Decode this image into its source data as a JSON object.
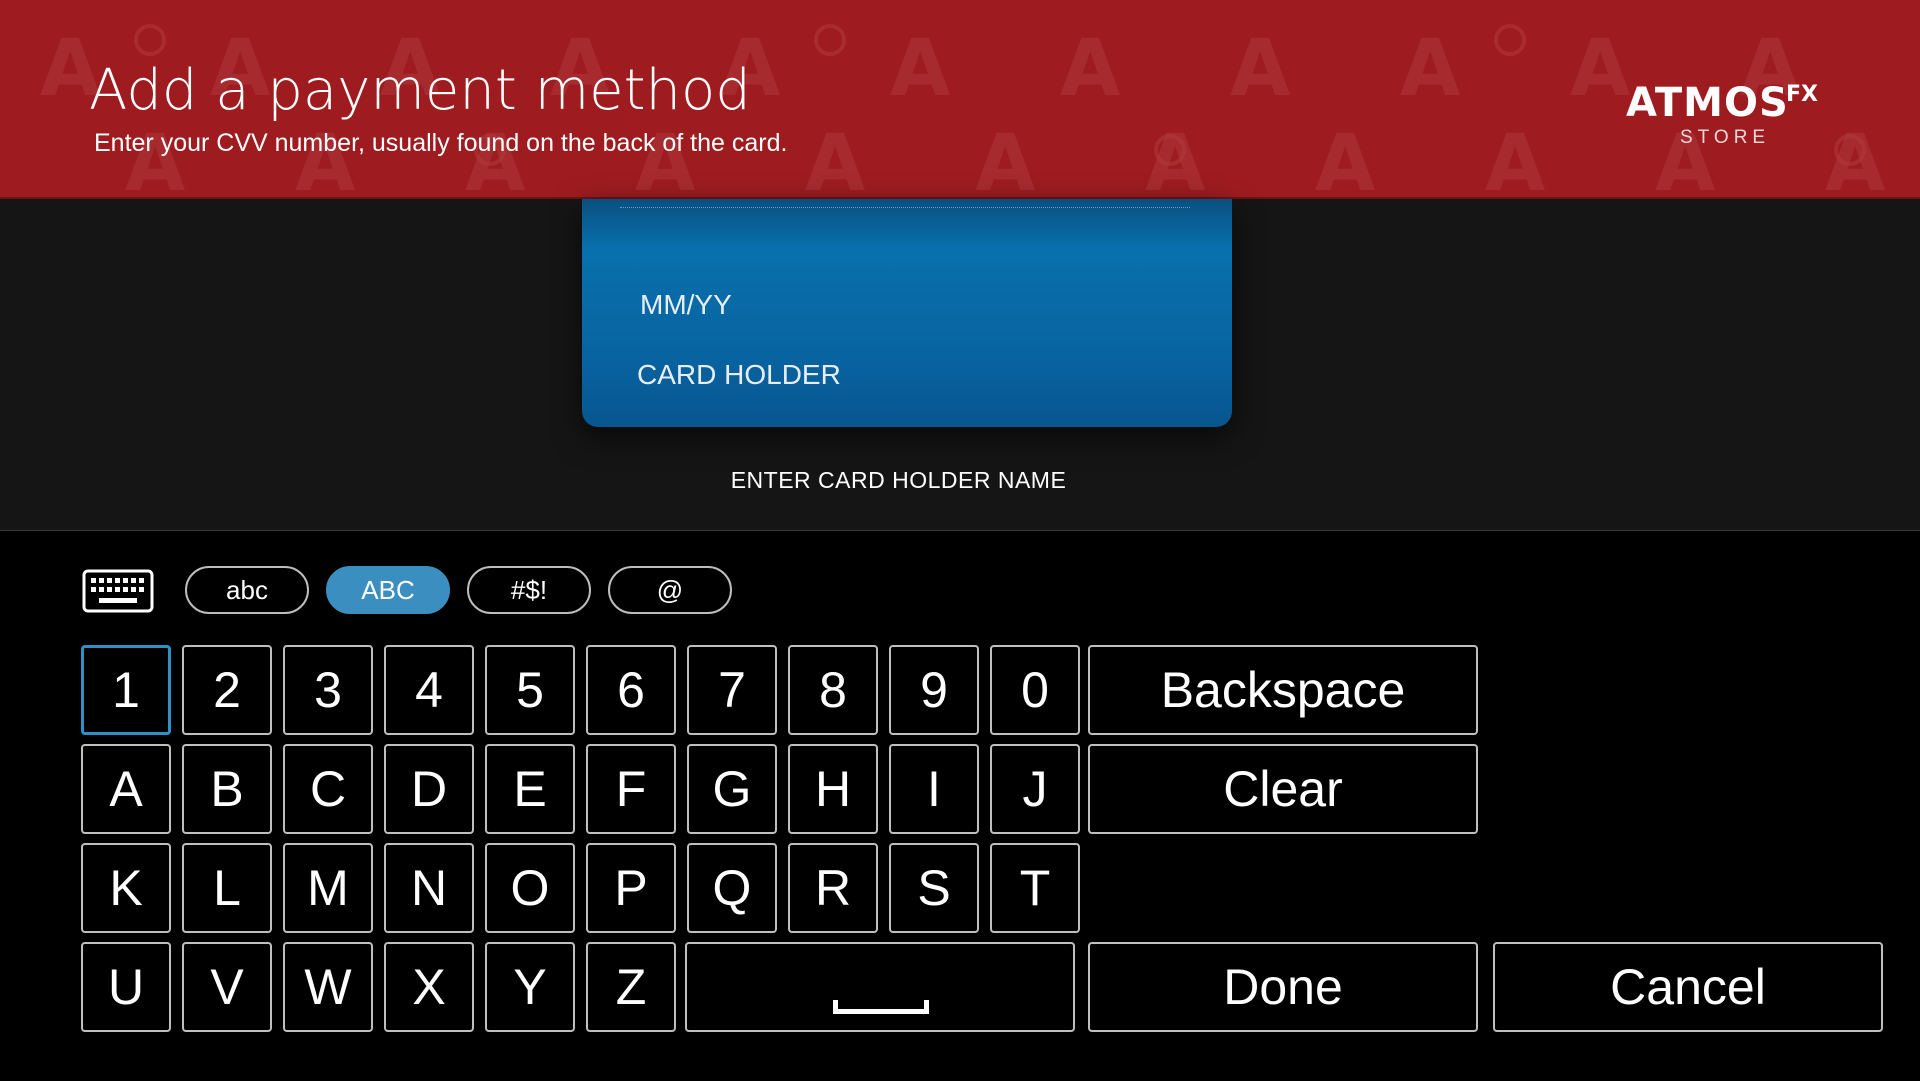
{
  "header": {
    "title": "Add a payment method",
    "subtitle": "Enter your CVV number, usually found on the back of the card.",
    "logo": {
      "brand": "ATMOS",
      "brand_sup": "FX",
      "store": "STORE"
    },
    "background_color": "#9e1c1f"
  },
  "card": {
    "expiry_label": "MM/YY",
    "holder_label": "CARD HOLDER",
    "caption": "ENTER CARD HOLDER NAME",
    "color": "#0871ad"
  },
  "keyboard": {
    "icon": "keyboard-icon",
    "modes": [
      {
        "label": "abc",
        "active": false
      },
      {
        "label": "ABC",
        "active": true
      },
      {
        "label": "#$!",
        "active": false
      },
      {
        "label": "@",
        "active": false
      }
    ],
    "rows": [
      [
        "1",
        "2",
        "3",
        "4",
        "5",
        "6",
        "7",
        "8",
        "9",
        "0"
      ],
      [
        "A",
        "B",
        "C",
        "D",
        "E",
        "F",
        "G",
        "H",
        "I",
        "J"
      ],
      [
        "K",
        "L",
        "M",
        "N",
        "O",
        "P",
        "Q",
        "R",
        "S",
        "T"
      ],
      [
        "U",
        "V",
        "W",
        "X",
        "Y",
        "Z"
      ]
    ],
    "focused_key": "1",
    "space_icon": "space-bar-icon",
    "actions": {
      "backspace": "Backspace",
      "clear": "Clear",
      "done": "Done",
      "cancel": "Cancel"
    },
    "accent_color": "#3a8fc0"
  }
}
